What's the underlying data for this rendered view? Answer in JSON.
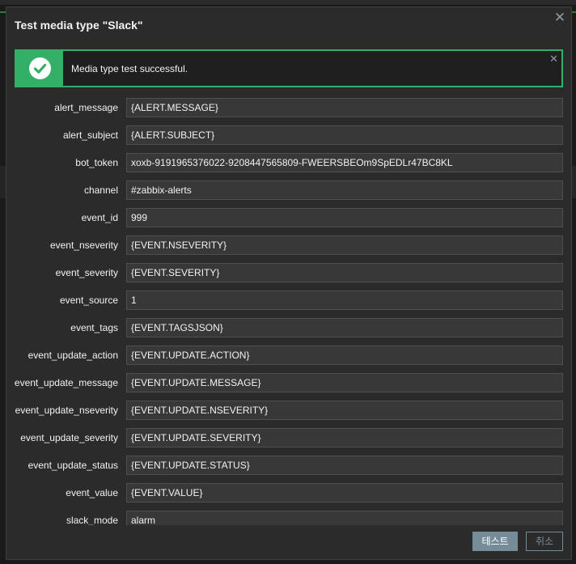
{
  "dialog": {
    "title": "Test media type \"Slack\"",
    "close_glyph": "✕",
    "close_icon": "close-icon"
  },
  "message": {
    "text": "Media type test successful.",
    "icon": "check-circle-icon",
    "close_glyph": "✕",
    "color": "#34af67"
  },
  "fields": [
    {
      "label": "alert_message",
      "value": "{ALERT.MESSAGE}"
    },
    {
      "label": "alert_subject",
      "value": "{ALERT.SUBJECT}"
    },
    {
      "label": "bot_token",
      "value": "xoxb-9191965376022-9208447565809-FWEERSBEOm9SpEDLr47BC8KL"
    },
    {
      "label": "channel",
      "value": "#zabbix-alerts"
    },
    {
      "label": "event_id",
      "value": "999"
    },
    {
      "label": "event_nseverity",
      "value": "{EVENT.NSEVERITY}"
    },
    {
      "label": "event_severity",
      "value": "{EVENT.SEVERITY}"
    },
    {
      "label": "event_source",
      "value": "1"
    },
    {
      "label": "event_tags",
      "value": "{EVENT.TAGSJSON}"
    },
    {
      "label": "event_update_action",
      "value": "{EVENT.UPDATE.ACTION}"
    },
    {
      "label": "event_update_message",
      "value": "{EVENT.UPDATE.MESSAGE}"
    },
    {
      "label": "event_update_nseverity",
      "value": "{EVENT.UPDATE.NSEVERITY}"
    },
    {
      "label": "event_update_severity",
      "value": "{EVENT.UPDATE.SEVERITY}"
    },
    {
      "label": "event_update_status",
      "value": "{EVENT.UPDATE.STATUS}"
    },
    {
      "label": "event_value",
      "value": "{EVENT.VALUE}"
    },
    {
      "label": "slack_mode",
      "value": "alarm"
    }
  ],
  "buttons": {
    "test_label": "테스트",
    "cancel_label": "취소"
  },
  "colors": {
    "accent": "#768d99",
    "success": "#34af67",
    "dialog_bg": "#2b2b2b",
    "input_bg": "#383838"
  }
}
